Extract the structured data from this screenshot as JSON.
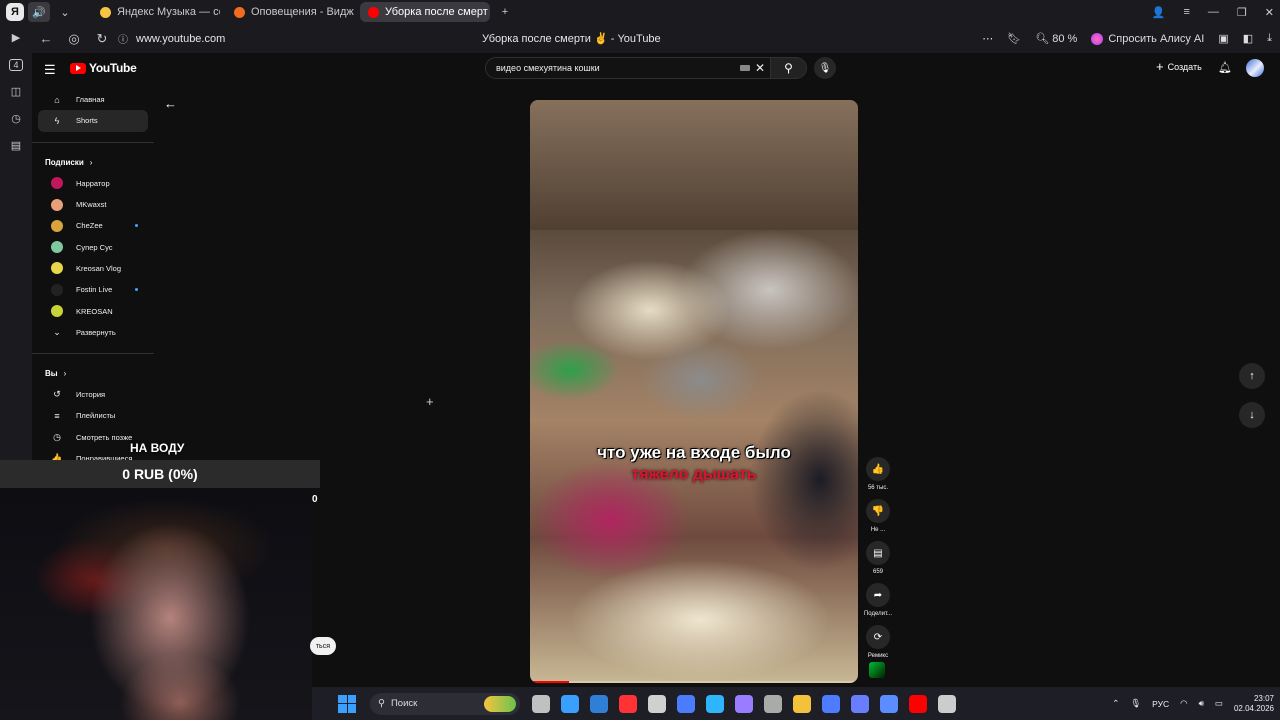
{
  "browser": {
    "tabs": [
      {
        "label": "Яндекс Музыка — собир",
        "color": "#f4c542",
        "active": false
      },
      {
        "label": "Оповещения - Виджеты",
        "color": "#f26b21",
        "active": false
      },
      {
        "label": "Уборка после смерт",
        "color": "#ff0000",
        "active": true
      }
    ],
    "url": "www.youtube.com",
    "page_title": "Уборка после смерти ✌ - YouTube",
    "zoom": "80 %",
    "alice_label": "Спросить Алису AI"
  },
  "rail": {
    "badge": "4"
  },
  "youtube": {
    "logo_text": "YouTube",
    "search_query": "видео  смехуятина кошки",
    "create_label": "Создать",
    "nav": [
      {
        "label": "Главная",
        "icon": "home-icon",
        "glyph": "⌂"
      },
      {
        "label": "Shorts",
        "icon": "shorts-icon",
        "glyph": "ϟ",
        "active": true
      }
    ],
    "subscriptions_header": "Подписки",
    "subscriptions": [
      {
        "label": "Нарратор",
        "color": "#c2185b",
        "live": false
      },
      {
        "label": "MKwaxst",
        "color": "#e8a07a",
        "live": false
      },
      {
        "label": "CheZee",
        "color": "#d9a43a",
        "live": true
      },
      {
        "label": "Супер Сус",
        "color": "#7fc9a0",
        "live": false
      },
      {
        "label": "Kreosan Vlog",
        "color": "#e7d84a",
        "live": false
      },
      {
        "label": "Fostin Live",
        "color": "#222222",
        "live": true
      },
      {
        "label": "KREOSAN",
        "color": "#c8d33a",
        "live": false
      }
    ],
    "expand_label": "Развернуть",
    "you_header": "Вы",
    "you_items": [
      {
        "label": "История",
        "glyph": "↺"
      },
      {
        "label": "Плейлисты",
        "glyph": "≡"
      },
      {
        "label": "Смотреть позже",
        "glyph": "◷"
      },
      {
        "label": "Понравившиеся",
        "glyph": "👍"
      }
    ],
    "short": {
      "caption_line1": "что уже на входе было",
      "caption_line2": "тяжело дышать",
      "progress": 0.12
    },
    "actions": [
      {
        "name": "like-button",
        "glyph": "👍",
        "label": "56 тыс."
      },
      {
        "name": "dislike-button",
        "glyph": "👎",
        "label": "Не ..."
      },
      {
        "name": "comments-button",
        "glyph": "▤",
        "label": "659"
      },
      {
        "name": "share-button",
        "glyph": "➦",
        "label": "Поделит..."
      },
      {
        "name": "remix-button",
        "glyph": "⟳",
        "label": "Ремикс"
      }
    ]
  },
  "overlay": {
    "label": "НА ВОДУ",
    "donation": "0 RUB (0%)",
    "cam_number": "0",
    "pill_text": "ться"
  },
  "taskbar": {
    "search_placeholder": "Поиск",
    "icons": [
      "#c0c0c0",
      "#3aa0ff",
      "#2f7fd6",
      "#ff3333",
      "#d0d0d0",
      "#4b7cff",
      "#2fb4ff",
      "#9a7cff",
      "#aaaaaa",
      "#f3c23a",
      "#4e7bff",
      "#6b7dff",
      "#5c8dff",
      "#ff0000",
      "#cccccc"
    ],
    "lang": "РУС",
    "time": "23:07",
    "date": "02.04.2026"
  }
}
